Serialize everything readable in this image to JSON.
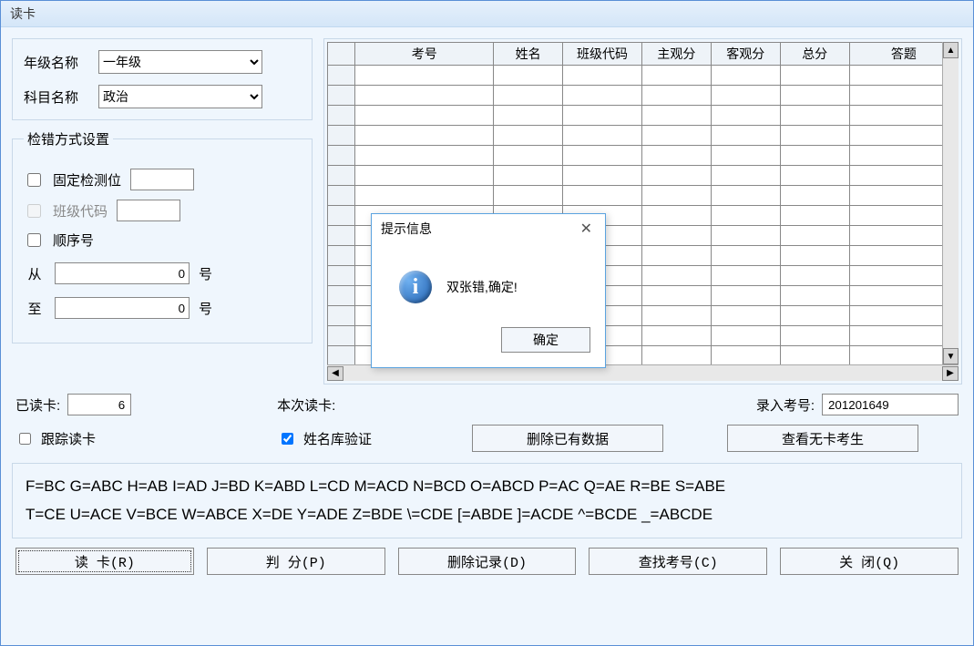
{
  "window": {
    "title": "读卡"
  },
  "form": {
    "grade_label": "年级名称",
    "grade_value": "一年级",
    "subject_label": "科目名称",
    "subject_value": "政治"
  },
  "check_settings": {
    "legend": "检错方式设置",
    "fixed_label": "固定检测位",
    "class_label": "班级代码",
    "seq_label": "顺序号",
    "from_label": "从",
    "to_label": "至",
    "unit": "号",
    "from_value": "0",
    "to_value": "0"
  },
  "table": {
    "headers": [
      "考号",
      "姓名",
      "班级代码",
      "主观分",
      "客观分",
      "总分",
      "答题"
    ]
  },
  "status": {
    "read_label": "已读卡:",
    "read_count": "6",
    "this_read_label": "本次读卡:",
    "input_id_label": "录入考号:",
    "input_id_value": "201201649",
    "track_label": "跟踪读卡",
    "verify_label": "姓名库验证",
    "delete_btn": "删除已有数据",
    "view_btn": "查看无卡考生"
  },
  "codes": {
    "line1": "F=BC  G=ABC  H=AB  I=AD  J=BD  K=ABD  L=CD  M=ACD  N=BCD  O=ABCD  P=AC  Q=AE  R=BE  S=ABE",
    "line2": "T=CE  U=ACE  V=BCE  W=ABCE  X=DE  Y=ADE  Z=BDE  \\=CDE  [=ABDE  ]=ACDE  ^=BCDE  _=ABCDE"
  },
  "buttons": {
    "read": "读  卡(R)",
    "judge": "判  分(P)",
    "delete": "删除记录(D)",
    "find": "查找考号(C)",
    "close": "关  闭(Q)"
  },
  "dialog": {
    "title": "提示信息",
    "message": "双张错,确定!",
    "ok": "确定"
  }
}
